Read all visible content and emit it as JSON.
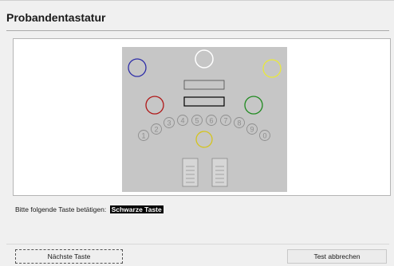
{
  "header": {
    "title": "Probandentastatur"
  },
  "keyboard": {
    "number_keys": [
      "1",
      "2",
      "3",
      "4",
      "5",
      "6",
      "7",
      "8",
      "9",
      "0"
    ],
    "circle_colors": {
      "top": "#ffffff",
      "top_left": "#2e2ea8",
      "top_right": "#e9e93a",
      "middle_left": "#b01818",
      "middle_right": "#1f8a1f",
      "bottom": "#d4c41e"
    }
  },
  "instruction": {
    "prompt": "Bitte folgende Taste betätigen:",
    "target_key": "Schwarze Taste"
  },
  "buttons": {
    "next_label": "Nächste Taste",
    "cancel_label": "Test abbrechen"
  }
}
